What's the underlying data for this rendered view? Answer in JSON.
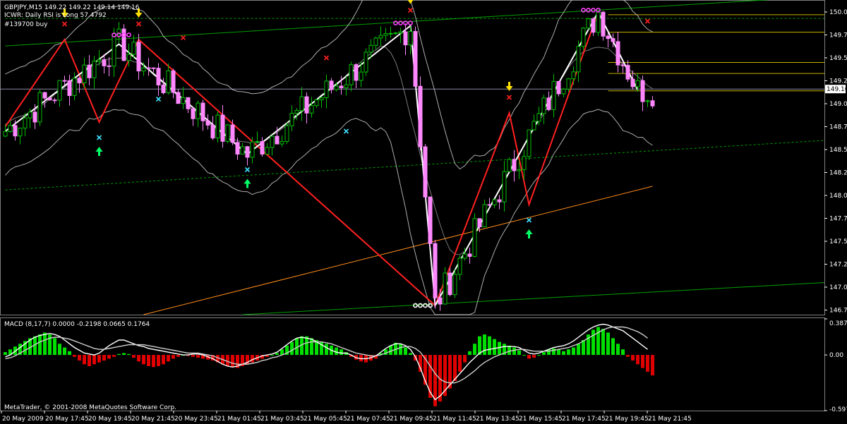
{
  "header": {
    "symbol_line": "GBPJPY,M15  149.22 149.22 149.14 149.16",
    "rsi_line": "ICWR: Daily RSI is Long 57.4792",
    "signal_line": "#139700 buy"
  },
  "macd_panel": {
    "label": "MACD  (8,17,7) 0.0000 -0.2198 0.0665 0.1764",
    "y_ticks": [
      "0.387",
      "0.00",
      "-0.5972"
    ],
    "y_range": [
      -0.5972,
      0.387
    ]
  },
  "footer": {
    "copyright": "MetaTrader, © 2001-2008 MetaQuotes Software Corp."
  },
  "colors": {
    "background": "#000000",
    "bull_candle": "#00c000",
    "bear_candle": "#ff88ff",
    "zigzag_white": "#ffffff",
    "zigzag_red": "#ff2020",
    "envelope": "#cccccc",
    "trend_green": "#00a000",
    "trend_orange": "#ff8c1a",
    "fib_level": "#c8b400",
    "macd_pos": "#00e000",
    "macd_neg": "#e00000",
    "arrow_yellow": "#ffe000",
    "arrow_green": "#00ff66",
    "marker_cyan": "#40e0ff",
    "marker_red": "#ff2020",
    "pivot_magenta": "#ff40ff"
  },
  "chart_data": [
    {
      "type": "candlestick",
      "title": "GBPJPY,M15",
      "ylim": [
        146.7,
        150.1
      ],
      "y_ticks": [
        "150.00",
        "149.75",
        "149.50",
        "149.25",
        "149.00",
        "148.75",
        "148.50",
        "148.25",
        "148.00",
        "147.75",
        "147.50",
        "147.25",
        "147.00",
        "146.75"
      ],
      "current_price": "149.16",
      "x_tick_labels": [
        "20 May 2009",
        "20 May 17:45",
        "20 May 19:45",
        "20 May 21:45",
        "20 May 23:45",
        "21 May 01:45",
        "21 May 03:45",
        "21 May 05:45",
        "21 May 07:45",
        "21 May 09:45",
        "21 May 11:45",
        "21 May 13:45",
        "21 May 15:45",
        "21 May 17:45",
        "21 May 19:45",
        "21 May 21:45"
      ],
      "zigzag_white": [
        {
          "bar": 0,
          "price": 148.7
        },
        {
          "bar": 23,
          "price": 149.65
        },
        {
          "bar": 49,
          "price": 148.45
        },
        {
          "bar": 82,
          "price": 149.85
        },
        {
          "bar": 87,
          "price": 146.8
        },
        {
          "bar": 120,
          "price": 150.0
        },
        {
          "bar": 128,
          "price": 149.15
        }
      ],
      "zigzag_red": [
        {
          "bar": 0,
          "price": 148.75
        },
        {
          "bar": 12,
          "price": 149.7
        },
        {
          "bar": 19,
          "price": 148.8
        },
        {
          "bar": 27,
          "price": 149.7
        },
        {
          "bar": 87,
          "price": 146.8
        },
        {
          "bar": 102,
          "price": 148.9
        },
        {
          "bar": 106,
          "price": 147.9
        },
        {
          "bar": 120,
          "price": 150.0
        }
      ],
      "fib_levels": [
        149.97,
        149.78,
        149.45,
        149.33,
        149.14
      ],
      "trend_lines": [
        {
          "color": "trend_green",
          "dashed": false,
          "from": {
            "bar": 0,
            "price": 149.63
          },
          "to": {
            "bar": 170,
            "price": 150.17
          }
        },
        {
          "color": "trend_green",
          "dashed": false,
          "from": {
            "bar": 48,
            "price": 146.7
          },
          "to": {
            "bar": 170,
            "price": 147.05
          }
        },
        {
          "color": "trend_green",
          "dashed": true,
          "from": {
            "bar": 0,
            "price": 148.06
          },
          "to": {
            "bar": 170,
            "price": 148.6
          }
        },
        {
          "color": "trend_green",
          "dashed": true,
          "from": {
            "bar": 0,
            "price": 149.93
          },
          "to": {
            "bar": 170,
            "price": 149.93
          }
        },
        {
          "color": "trend_orange",
          "dashed": false,
          "from": {
            "bar": 28,
            "price": 146.7
          },
          "to": {
            "bar": 131,
            "price": 148.1
          }
        }
      ]
    },
    {
      "type": "bar",
      "title": "MACD (8,17,7)",
      "ylim": [
        -0.5972,
        0.387
      ],
      "histogram": [
        0.03,
        0.06,
        0.09,
        0.12,
        0.15,
        0.18,
        0.2,
        0.22,
        0.24,
        0.22,
        0.18,
        0.12,
        0.08,
        0.04,
        -0.02,
        -0.06,
        -0.1,
        -0.12,
        -0.1,
        -0.08,
        -0.06,
        -0.04,
        -0.02,
        0.01,
        0.02,
        0.01,
        -0.03,
        -0.07,
        -0.1,
        -0.12,
        -0.13,
        -0.12,
        -0.1,
        -0.07,
        -0.04,
        -0.02,
        0.0,
        -0.01,
        -0.02,
        -0.03,
        -0.04,
        -0.05,
        -0.06,
        -0.08,
        -0.1,
        -0.12,
        -0.13,
        -0.14,
        -0.12,
        -0.1,
        -0.08,
        -0.06,
        -0.04,
        -0.02,
        0.0,
        0.02,
        0.06,
        0.1,
        0.14,
        0.18,
        0.2,
        0.2,
        0.18,
        0.16,
        0.14,
        0.12,
        0.1,
        0.08,
        0.06,
        0.03,
        -0.02,
        -0.05,
        -0.07,
        -0.08,
        -0.06,
        -0.04,
        0.02,
        0.06,
        0.1,
        0.13,
        0.12,
        0.08,
        0.02,
        -0.06,
        -0.18,
        -0.32,
        -0.46,
        -0.55,
        -0.5,
        -0.44,
        -0.36,
        -0.28,
        -0.18,
        -0.08,
        0.04,
        0.12,
        0.2,
        0.22,
        0.2,
        0.17,
        0.14,
        0.12,
        0.1,
        0.08,
        0.05,
        0.0,
        -0.04,
        -0.03,
        0.0,
        0.03,
        0.06,
        0.07,
        0.06,
        0.04,
        0.06,
        0.08,
        0.12,
        0.16,
        0.22,
        0.27,
        0.3,
        0.28,
        0.24,
        0.18,
        0.12,
        0.06,
        -0.02,
        -0.06,
        -0.1,
        -0.14,
        -0.18,
        -0.22
      ],
      "macd_line": [
        -0.02,
        0.0,
        0.04,
        0.08,
        0.12,
        0.16,
        0.19,
        0.21,
        0.22,
        0.23,
        0.22,
        0.2,
        0.16,
        0.12,
        0.08,
        0.05,
        0.02,
        0.01,
        0.0,
        0.02,
        0.06,
        0.1,
        0.13,
        0.16,
        0.16,
        0.14,
        0.12,
        0.1,
        0.09,
        0.07,
        0.06,
        0.05,
        0.04,
        0.03,
        0.02,
        0.01,
        0.0,
        0.0,
        0.01,
        0.01,
        0.0,
        -0.02,
        -0.04,
        -0.07,
        -0.1,
        -0.12,
        -0.13,
        -0.12,
        -0.1,
        -0.08,
        -0.05,
        -0.03,
        -0.01,
        0.0,
        0.01,
        0.03,
        0.07,
        0.11,
        0.15,
        0.18,
        0.19,
        0.18,
        0.17,
        0.14,
        0.11,
        0.08,
        0.05,
        0.03,
        0.02,
        0.02,
        0.0,
        -0.03,
        -0.04,
        -0.04,
        -0.03,
        -0.01,
        0.03,
        0.07,
        0.1,
        0.12,
        0.12,
        0.1,
        0.06,
        -0.02,
        -0.14,
        -0.28,
        -0.4,
        -0.48,
        -0.44,
        -0.38,
        -0.32,
        -0.26,
        -0.2,
        -0.14,
        -0.08,
        -0.03,
        0.02,
        0.05,
        0.06,
        0.07,
        0.08,
        0.09,
        0.09,
        0.09,
        0.08,
        0.05,
        0.02,
        0.01,
        0.02,
        0.04,
        0.06,
        0.08,
        0.09,
        0.1,
        0.12,
        0.15,
        0.19,
        0.23,
        0.27,
        0.3,
        0.32,
        0.33,
        0.32,
        0.3,
        0.28,
        0.26,
        0.22,
        0.18,
        0.14,
        0.1,
        0.06
      ],
      "signal_line": [
        -0.04,
        -0.03,
        -0.01,
        0.02,
        0.05,
        0.08,
        0.11,
        0.14,
        0.16,
        0.18,
        0.19,
        0.19,
        0.18,
        0.17,
        0.15,
        0.13,
        0.11,
        0.09,
        0.07,
        0.06,
        0.06,
        0.07,
        0.08,
        0.09,
        0.1,
        0.11,
        0.11,
        0.11,
        0.11,
        0.1,
        0.09,
        0.08,
        0.07,
        0.06,
        0.05,
        0.04,
        0.03,
        0.02,
        0.02,
        0.02,
        0.01,
        0.0,
        -0.01,
        -0.03,
        -0.05,
        -0.07,
        -0.09,
        -0.1,
        -0.1,
        -0.1,
        -0.09,
        -0.08,
        -0.06,
        -0.05,
        -0.03,
        -0.02,
        0.0,
        0.02,
        0.05,
        0.08,
        0.11,
        0.13,
        0.14,
        0.14,
        0.14,
        0.13,
        0.12,
        0.1,
        0.08,
        0.06,
        0.04,
        0.02,
        0.01,
        0.0,
        -0.01,
        -0.01,
        0.0,
        0.02,
        0.04,
        0.06,
        0.08,
        0.09,
        0.09,
        0.07,
        0.03,
        -0.04,
        -0.12,
        -0.2,
        -0.26,
        -0.29,
        -0.3,
        -0.3,
        -0.28,
        -0.25,
        -0.21,
        -0.17,
        -0.12,
        -0.08,
        -0.05,
        -0.02,
        0.0,
        0.02,
        0.04,
        0.05,
        0.06,
        0.06,
        0.05,
        0.04,
        0.04,
        0.04,
        0.04,
        0.05,
        0.06,
        0.07,
        0.08,
        0.1,
        0.12,
        0.15,
        0.18,
        0.21,
        0.24,
        0.27,
        0.29,
        0.3,
        0.3,
        0.3,
        0.29,
        0.27,
        0.25,
        0.22,
        0.18
      ]
    }
  ]
}
